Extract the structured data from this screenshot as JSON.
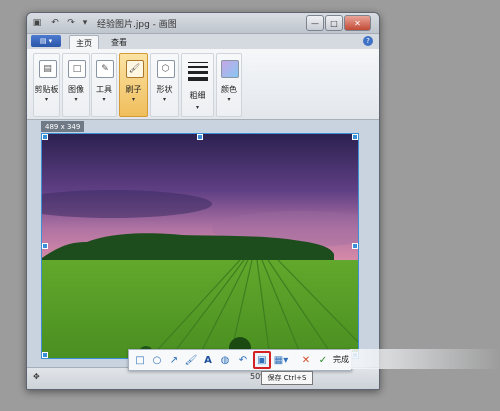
{
  "window": {
    "title": "经验图片.jpg - 画图"
  },
  "ribbon": {
    "tabs": [
      {
        "label": "主页"
      },
      {
        "label": "查看"
      }
    ],
    "groups": [
      {
        "label": "剪贴板",
        "icon": "clipboard-icon"
      },
      {
        "label": "图像",
        "icon": "image-icon"
      },
      {
        "label": "工具",
        "icon": "tools-icon"
      },
      {
        "label": "刷子",
        "icon": "brush-icon"
      },
      {
        "label": "形状",
        "icon": "shapes-icon"
      },
      {
        "label": "粗细",
        "icon": "line-width-icon"
      },
      {
        "label": "颜色",
        "icon": "color-icon"
      }
    ]
  },
  "canvas": {
    "size_tip": "489 x 349"
  },
  "status": {
    "zoom": "50%"
  },
  "floating_toolbar": {
    "done_label": "完成",
    "tooltip": "保存 Ctrl+S"
  },
  "colors": {
    "accent_blue": "#3a8fd6",
    "save_highlight": "#d42020",
    "sky_top": "#2c2150",
    "sky_bottom": "#d58aa8",
    "grass": "#62a82c"
  }
}
